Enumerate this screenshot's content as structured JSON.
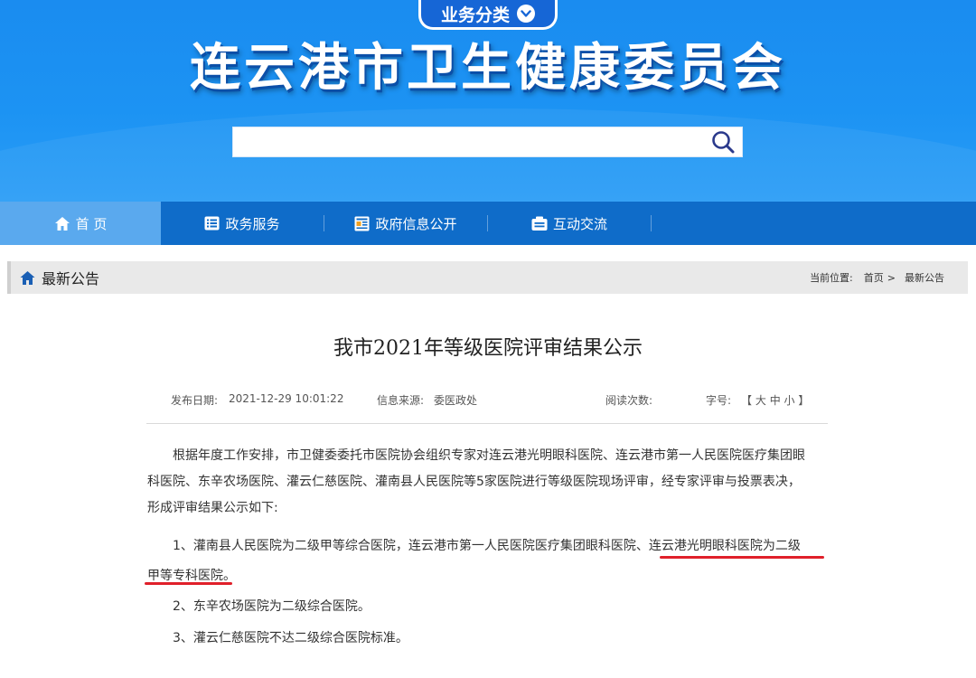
{
  "header": {
    "category_label": "业务分类",
    "site_title": "连云港市卫生健康委员会",
    "search_placeholder": ""
  },
  "nav": {
    "items": [
      {
        "label": "首 页",
        "icon": "home-icon",
        "active": true
      },
      {
        "label": "政务服务",
        "icon": "list-icon",
        "active": false
      },
      {
        "label": "政府信息公开",
        "icon": "document-icon",
        "active": false
      },
      {
        "label": "互动交流",
        "icon": "chat-icon",
        "active": false
      }
    ]
  },
  "breadcrumb": {
    "section_title": "最新公告",
    "location_label": "当前位置:",
    "home": "首页",
    "separator": ">",
    "current": "最新公告"
  },
  "article": {
    "title": "我市2021年等级医院评审结果公示",
    "publish_label": "发布日期:",
    "publish_date": "2021-12-29 10:01:22",
    "source_label": "信息来源:",
    "source": "委医政处",
    "views_label": "阅读次数:",
    "font_label": "字号:",
    "font_open": "【",
    "font_large": "大",
    "font_medium": "中",
    "font_small": "小",
    "font_close": "】",
    "p1_line1": "根据年度工作安排，市卫健委委托市医院协会组织专家对连云港光明眼科医院、连云港市第一人民医院医疗集团眼",
    "p1_line2": "科医院、东辛农场医院、灌云仁慈医院、灌南县人民医院等5家医院进行等级医院现场评审，经专家评审与投票表决，",
    "p1_line3": "形成评审结果公示如下:",
    "p2_line1": "1、灌南县人民医院为二级甲等综合医院，连云港市第一人民医院医疗集团眼科医院、连云港光明眼科医院为二级",
    "p2_line2": "甲等专科医院。",
    "p3": "2、东辛农场医院为二级综合医院。",
    "p4": "3、灌云仁慈医院不达二级综合医院标准。"
  },
  "colors": {
    "header_blue": "#1c93f3",
    "nav_blue": "#0f6cc9",
    "nav_active": "#5aa9ee",
    "highlight_red": "#e0202a"
  }
}
